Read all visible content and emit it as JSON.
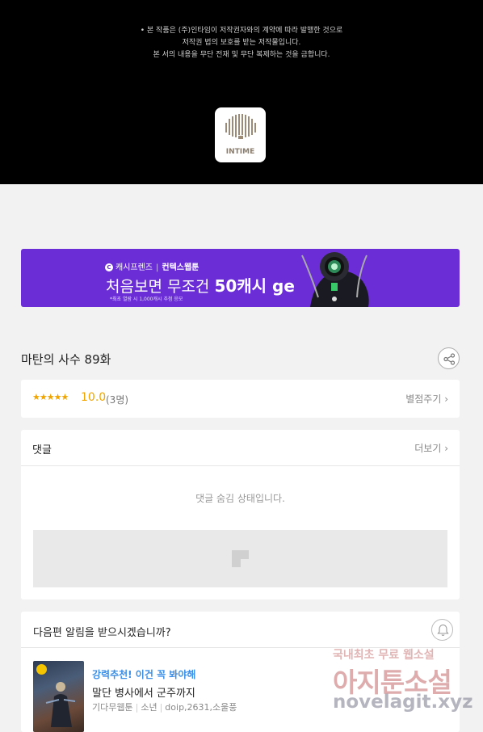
{
  "copyright": {
    "lines": [
      "• 본 작품은 (주)인타임이 저작권자와의 계약에 따라 발행한 것으로",
      "저작권 법의 보호를 받는 저작물입니다.",
      "본 서의 내용을 무단 전재 및 무단 복제하는 것을 금합니다."
    ],
    "logo_text": "INTIME"
  },
  "banner": {
    "brand_left": "캐시프렌즈",
    "brand_right": "컨텍스웹툰",
    "headline_pre": "처음보면 무조건 ",
    "headline_big": "50캐시 get!!",
    "fine_print": "*최초 열람 시 1,000캐시 추첨 응모"
  },
  "episode": {
    "title": "마탄의 사수 89화",
    "share_icon": "share-icon"
  },
  "rating": {
    "stars": "★★★★★",
    "score": "10.0",
    "count": "(3명)",
    "rate_button": "별점주기 ›"
  },
  "comments": {
    "title": "댓글",
    "more": "더보기 ›",
    "hidden_message": "댓글 숨김 상태입니다."
  },
  "next_alert": {
    "title": "다음편 알림을 받으시겠습니까?",
    "bell_icon": "bell-icon"
  },
  "recommend": {
    "label": "강력추천! 이건 꼭 봐야해",
    "title": "말단 병사에서 군주까지",
    "genre": "기다무웹툰",
    "category": "소년",
    "authors": "doip,2631,소울풍"
  },
  "watermark": {
    "line1": "국내최초 무료 웹소설",
    "line2": "아지툰소설",
    "line3": "novelagit.xyz"
  },
  "colors": {
    "banner": "#6b2ed6",
    "star": "#f0a400",
    "accent_blue": "#3a8ee6"
  }
}
